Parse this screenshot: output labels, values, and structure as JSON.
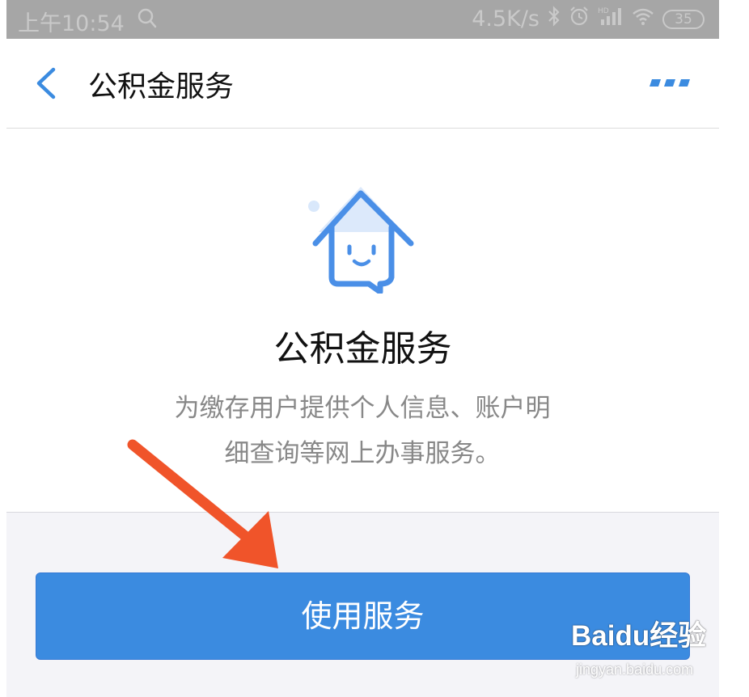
{
  "status_bar": {
    "time": "上午10:54",
    "network_speed": "4.5K/s",
    "battery_level": "35",
    "icons": [
      "search-icon",
      "bluetooth-icon",
      "alarm-icon",
      "hd-signal-icon",
      "wifi-icon",
      "battery-icon"
    ]
  },
  "nav": {
    "title": "公积金服务",
    "back_icon": "chevron-left-icon",
    "more_icon": "more-dots-icon"
  },
  "service": {
    "icon": "house-smile-icon",
    "heading": "公积金服务",
    "description_line1": "为缴存用户提供个人信息、账户明",
    "description_line2": "细查询等网上办事服务。"
  },
  "action": {
    "button_label": "使用服务"
  },
  "watermark": {
    "logo_text": "Baidu经验",
    "url": "jingyan.baidu.com"
  },
  "colors": {
    "accent": "#3b8be0",
    "status_bar": "#a6a6a6",
    "annotation_arrow": "#f0542a",
    "description_text": "#888888"
  }
}
